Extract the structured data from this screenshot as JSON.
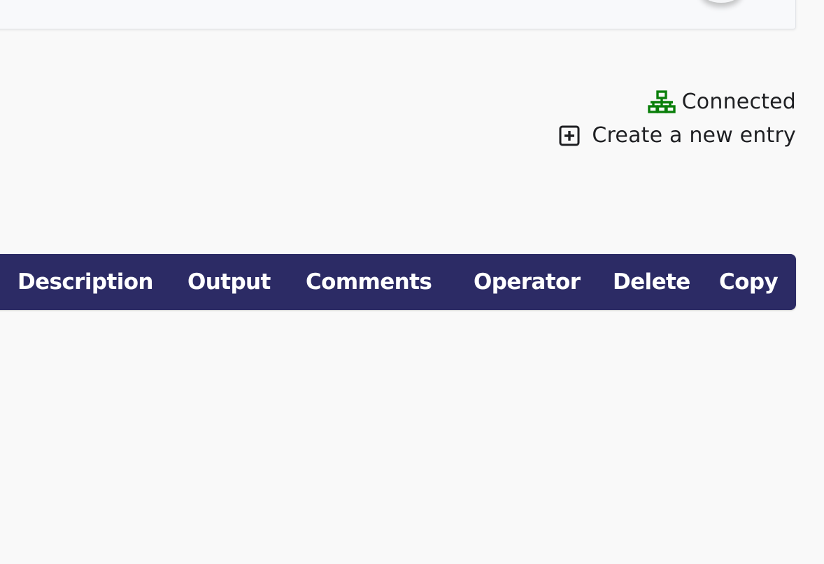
{
  "status": {
    "label": "Connected",
    "icon": "network-icon",
    "color": "#0a7f0a"
  },
  "actions": {
    "create_label": "Create a new entry",
    "create_icon": "plus-box-icon"
  },
  "table": {
    "header_color": "#2c2b65",
    "columns": [
      "Description",
      "Output",
      "Comments",
      "Operator",
      "Delete",
      "Copy"
    ]
  }
}
